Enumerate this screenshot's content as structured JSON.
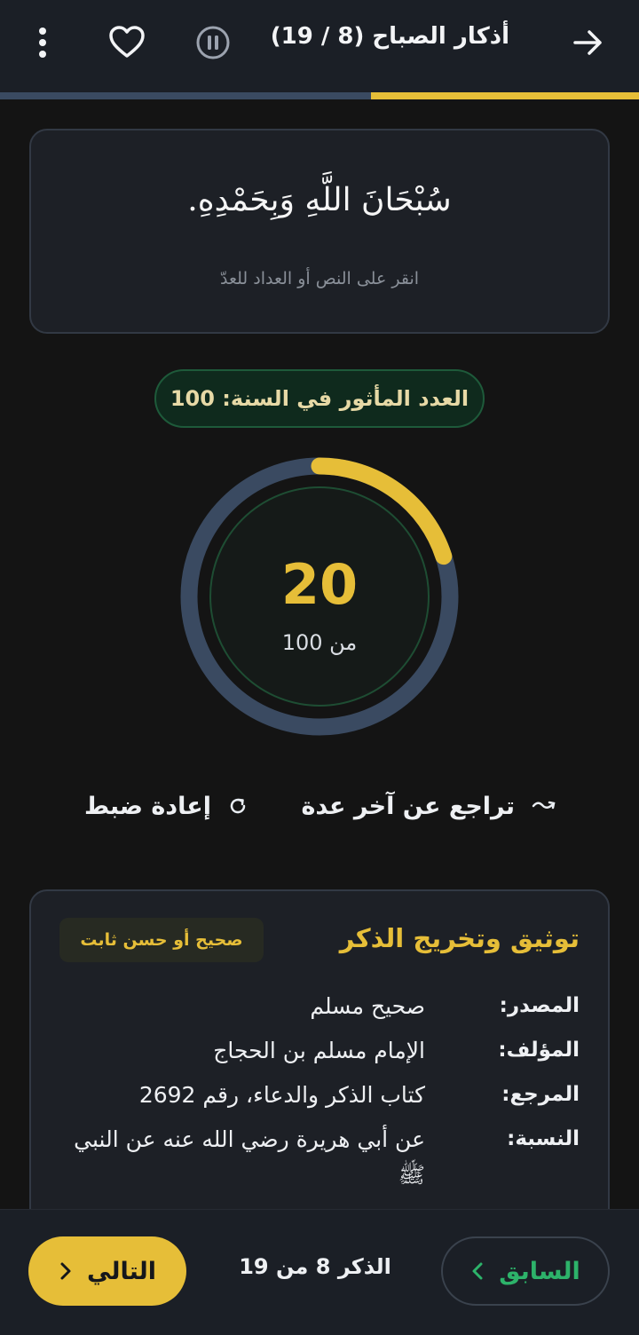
{
  "header": {
    "title": "أذكار الصباح (8 / 19)",
    "progress": 0.42,
    "icons": {
      "back": "arrow-right-icon",
      "pause": "pause-circle-icon",
      "favorite": "heart-icon",
      "menu": "more-vertical-icon"
    }
  },
  "zikr": {
    "text": "سُبْحَانَ اللَّهِ وَبِحَمْدِهِ.",
    "hint": "انقر على النص أو العداد للعدّ"
  },
  "sunnah_count_label": "العدد المأثور في السنة: 100",
  "counter": {
    "current": 20,
    "target": 100,
    "total_label": "من 100"
  },
  "actions": {
    "undo": "تراجع عن آخر عدة",
    "reset": "إعادة ضبط"
  },
  "source": {
    "title": "توثيق وتخريج الذكر",
    "grade": "صحيح أو حسن ثابت",
    "rows": [
      {
        "key": "المصدر:",
        "value": "صحيح مسلم"
      },
      {
        "key": "المؤلف:",
        "value": "الإمام مسلم بن الحجاج"
      },
      {
        "key": "المرجع:",
        "value": "كتاب الذكر والدعاء، رقم 2692"
      },
      {
        "key": "النسبة:",
        "value": "عن أبي هريرة رضي الله عنه عن النبي ﷺ"
      }
    ]
  },
  "footer": {
    "prev_label": "السابق",
    "position_label": "الذكر 8 من 19",
    "next_label": "التالي"
  },
  "colors": {
    "accent": "#e6be38",
    "green": "#2db36a",
    "ring_track": "#3a4a61",
    "background": "#141414"
  }
}
